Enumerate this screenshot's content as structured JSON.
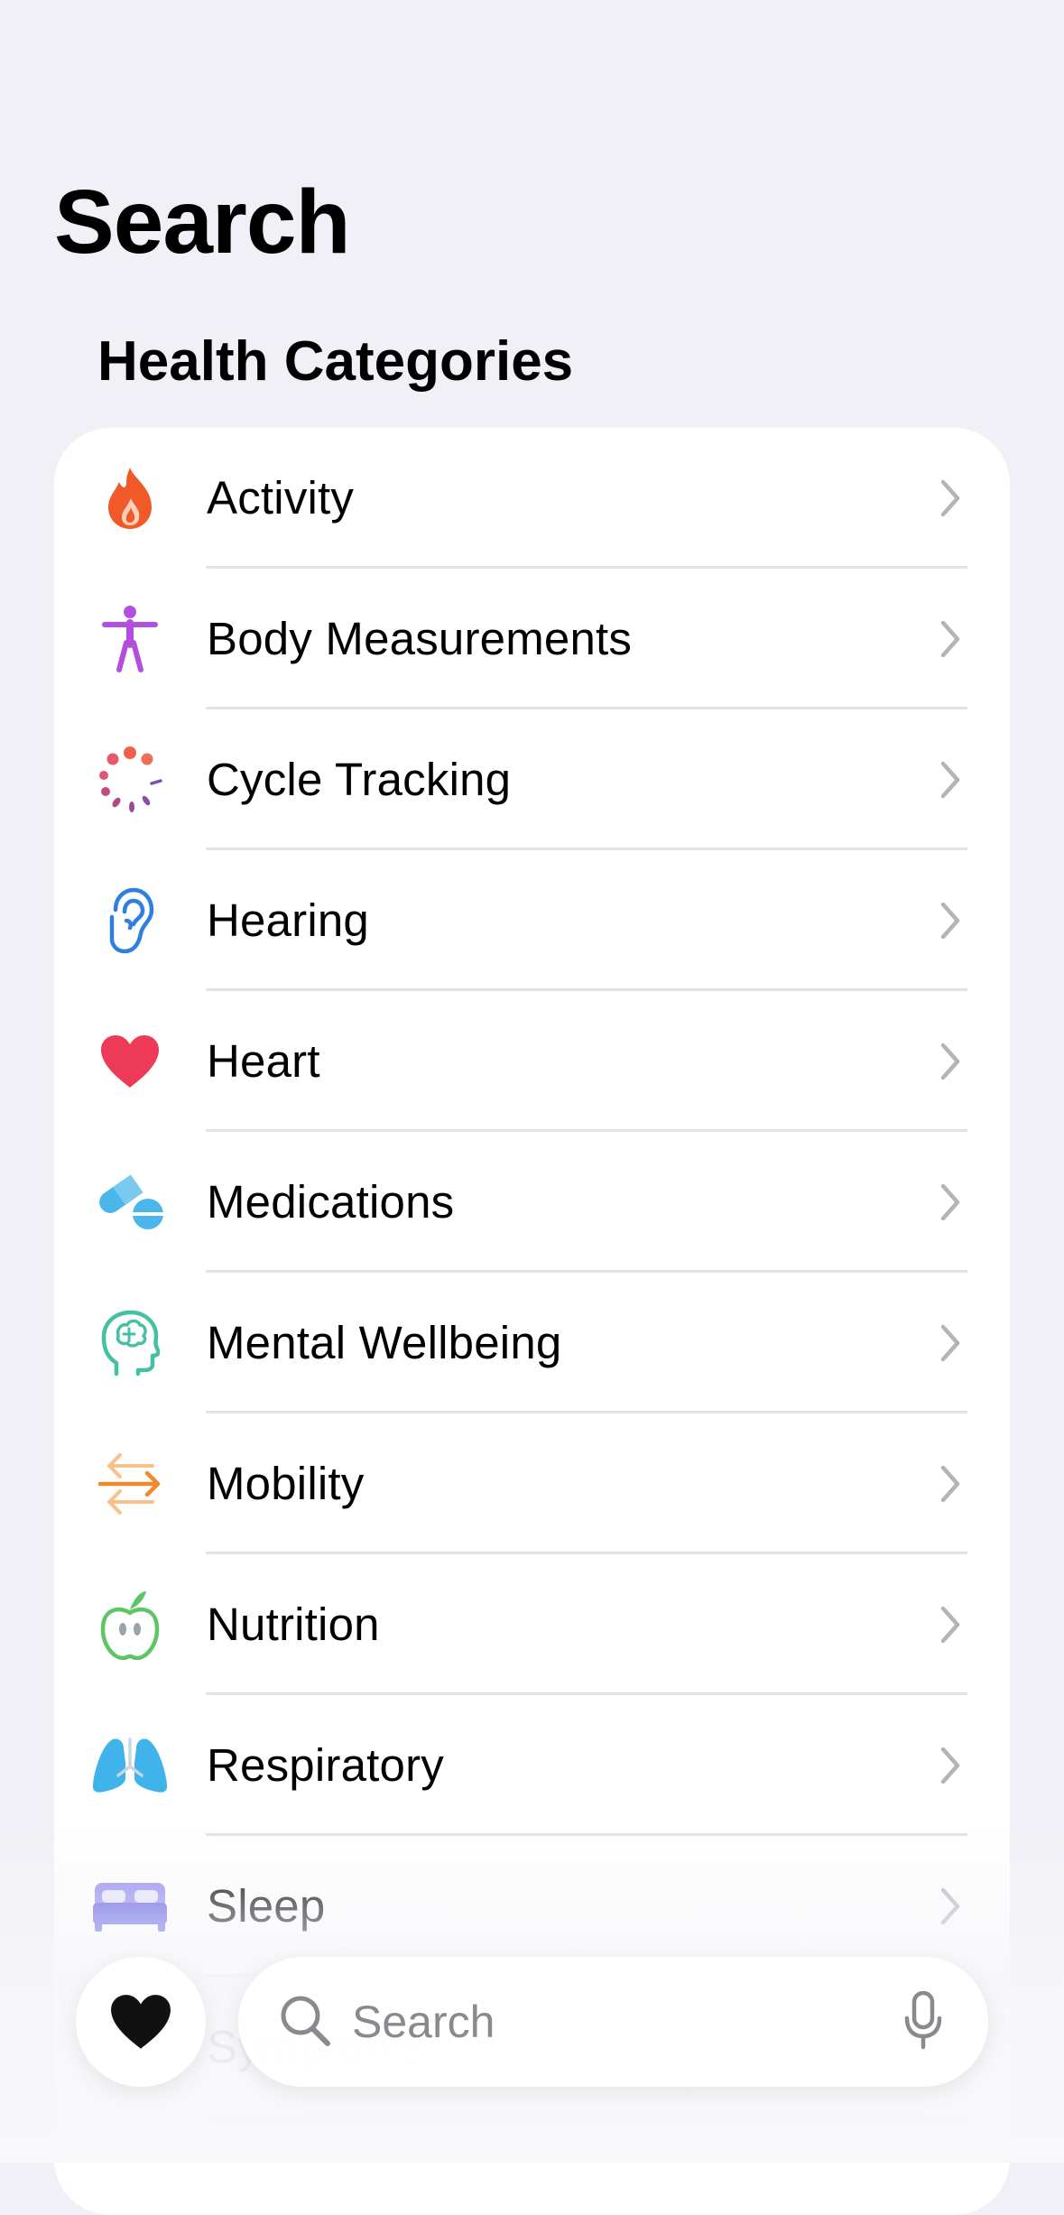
{
  "header": {
    "title": "Search"
  },
  "section": {
    "title": "Health Categories"
  },
  "categories": [
    {
      "label": "Activity",
      "icon": "flame-icon",
      "color": "#f05a28"
    },
    {
      "label": "Body Measurements",
      "icon": "figure-icon",
      "color": "#b34fe0"
    },
    {
      "label": "Cycle Tracking",
      "icon": "cycle-dots-icon",
      "color": "#e3566b"
    },
    {
      "label": "Hearing",
      "icon": "ear-icon",
      "color": "#2f7ee0"
    },
    {
      "label": "Heart",
      "icon": "heart-icon",
      "color": "#ee3a59"
    },
    {
      "label": "Medications",
      "icon": "pills-icon",
      "color": "#4ab6ea"
    },
    {
      "label": "Mental Wellbeing",
      "icon": "brain-head-icon",
      "color": "#45c0a5"
    },
    {
      "label": "Mobility",
      "icon": "arrows-icon",
      "color": "#f08a2c"
    },
    {
      "label": "Nutrition",
      "icon": "apple-icon",
      "color": "#5cc564"
    },
    {
      "label": "Respiratory",
      "icon": "lungs-icon",
      "color": "#3fb3ea"
    },
    {
      "label": "Sleep",
      "icon": "bed-icon",
      "color": "#5a56e0"
    },
    {
      "label": "Symptoms",
      "icon": "symptoms-icon",
      "color": "#5a56e0"
    }
  ],
  "bottom_bar": {
    "heart_icon": "heart-fill-icon",
    "search_placeholder": "Search",
    "mic_icon": "microphone-icon"
  }
}
